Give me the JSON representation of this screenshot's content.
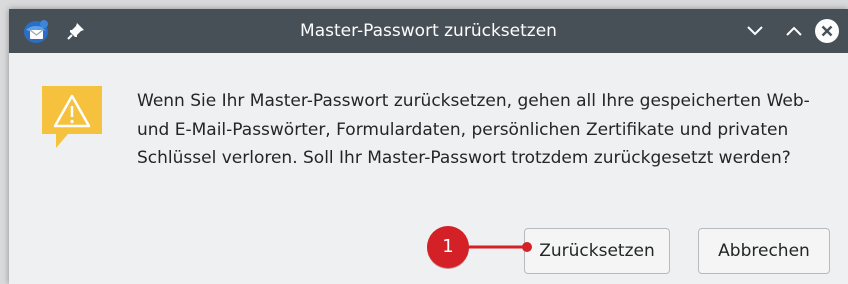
{
  "window": {
    "title": "Master-Passwort zurücksetzen",
    "titlebar_color": "#475057",
    "icons": [
      "thunderbird-app-icon",
      "pin-icon",
      "chevron-down-icon",
      "chevron-up-icon",
      "close-icon"
    ]
  },
  "dialog": {
    "icon": "warning-icon",
    "icon_color": "#f6c23e",
    "message": "Wenn Sie Ihr Master-Passwort zurücksetzen, gehen all Ihre gespeicherten Web- und E-Mail-Passwörter, Formulardaten, persönlichen Zertifikate und privaten Schlüssel verloren. Soll Ihr Master-Passwort trotzdem zurückgesetzt werden?",
    "buttons": {
      "reset_label": "Zurücksetzen",
      "cancel_label": "Abbrechen"
    }
  },
  "annotation": {
    "step_number": "1",
    "color": "#d42027"
  }
}
